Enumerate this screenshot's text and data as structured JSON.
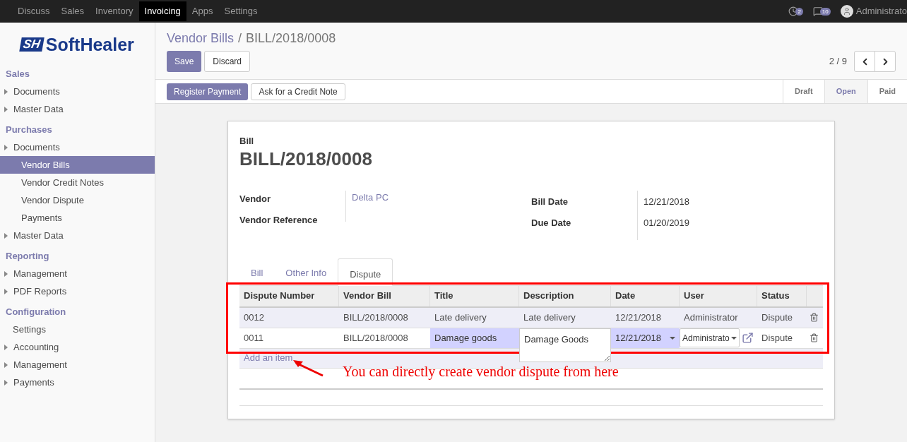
{
  "top_menu": [
    {
      "label": "Discuss",
      "selected": false
    },
    {
      "label": "Sales",
      "selected": false
    },
    {
      "label": "Inventory",
      "selected": false
    },
    {
      "label": "Invoicing",
      "selected": true
    },
    {
      "label": "Apps",
      "selected": false
    },
    {
      "label": "Settings",
      "selected": false
    }
  ],
  "systray": {
    "activity_badge": "2",
    "messages_badge": "10",
    "user": "Administrato"
  },
  "logo": {
    "mark": "SH",
    "text": "SoftHealer"
  },
  "sidebar": [
    {
      "section": "Sales",
      "items": [
        {
          "label": "Documents",
          "kind": "folder",
          "selected": false
        },
        {
          "label": "Master Data",
          "kind": "folder",
          "selected": false
        }
      ]
    },
    {
      "section": "Purchases",
      "items": [
        {
          "label": "Documents",
          "kind": "folder",
          "selected": false,
          "children": [
            {
              "label": "Vendor Bills",
              "selected": true
            },
            {
              "label": "Vendor Credit Notes",
              "selected": false
            },
            {
              "label": "Vendor Dispute",
              "selected": false
            },
            {
              "label": "Payments",
              "selected": false
            }
          ]
        },
        {
          "label": "Master Data",
          "kind": "folder",
          "selected": false
        }
      ]
    },
    {
      "section": "Reporting",
      "items": [
        {
          "label": "Management",
          "kind": "folder",
          "selected": false
        },
        {
          "label": "PDF Reports",
          "kind": "folder",
          "selected": false
        }
      ]
    },
    {
      "section": "Configuration",
      "items": [
        {
          "label": "Settings",
          "kind": "leaf",
          "selected": false
        },
        {
          "label": "Accounting",
          "kind": "folder",
          "selected": false
        },
        {
          "label": "Management",
          "kind": "folder",
          "selected": false
        },
        {
          "label": "Payments",
          "kind": "folder",
          "selected": false
        }
      ]
    }
  ],
  "breadcrumb": {
    "parent": "Vendor Bills",
    "separator": "/",
    "current": "BILL/2018/0008"
  },
  "buttons": {
    "save": "Save",
    "discard": "Discard"
  },
  "pager": "2 / 9",
  "actions": [
    {
      "label": "Register Payment",
      "kind": "primary"
    },
    {
      "label": "Ask for a Credit Note",
      "kind": "secondary"
    }
  ],
  "status_steps": [
    {
      "label": "Draft",
      "selected": false
    },
    {
      "label": "Open",
      "selected": true
    },
    {
      "label": "Paid",
      "selected": false
    }
  ],
  "sheet": {
    "label": "Bill",
    "title": "BILL/2018/0008",
    "left_fields": [
      {
        "label": "Vendor",
        "value": "Delta PC"
      },
      {
        "label": "Vendor Reference"
      }
    ],
    "right_fields": [
      {
        "label": "Bill Date",
        "value": "12/21/2018"
      },
      {
        "label": "Due Date",
        "value": "01/20/2019"
      }
    ],
    "tabs": [
      {
        "label": "Bill",
        "selected": false
      },
      {
        "label": "Other Info",
        "selected": false
      },
      {
        "label": "Dispute",
        "selected": true
      }
    ],
    "table": {
      "columns": [
        "Dispute Number",
        "Vendor Bill",
        "Title",
        "Description",
        "Date",
        "User",
        "Status"
      ],
      "rows": [
        {
          "kind": "view",
          "cells": [
            "0012",
            "BILL/2018/0008",
            "Late delivery",
            "Late delivery",
            "12/21/2018",
            "Administrator",
            "Dispute"
          ]
        },
        {
          "kind": "edit",
          "cells": [
            "0011",
            "BILL/2018/0008",
            "Damage goods",
            "Damage Goods",
            "12/21/2018",
            "Administrato",
            "Dispute"
          ]
        }
      ],
      "add_item": "Add an item"
    }
  },
  "annotation": "You can directly create vendor dispute from here"
}
